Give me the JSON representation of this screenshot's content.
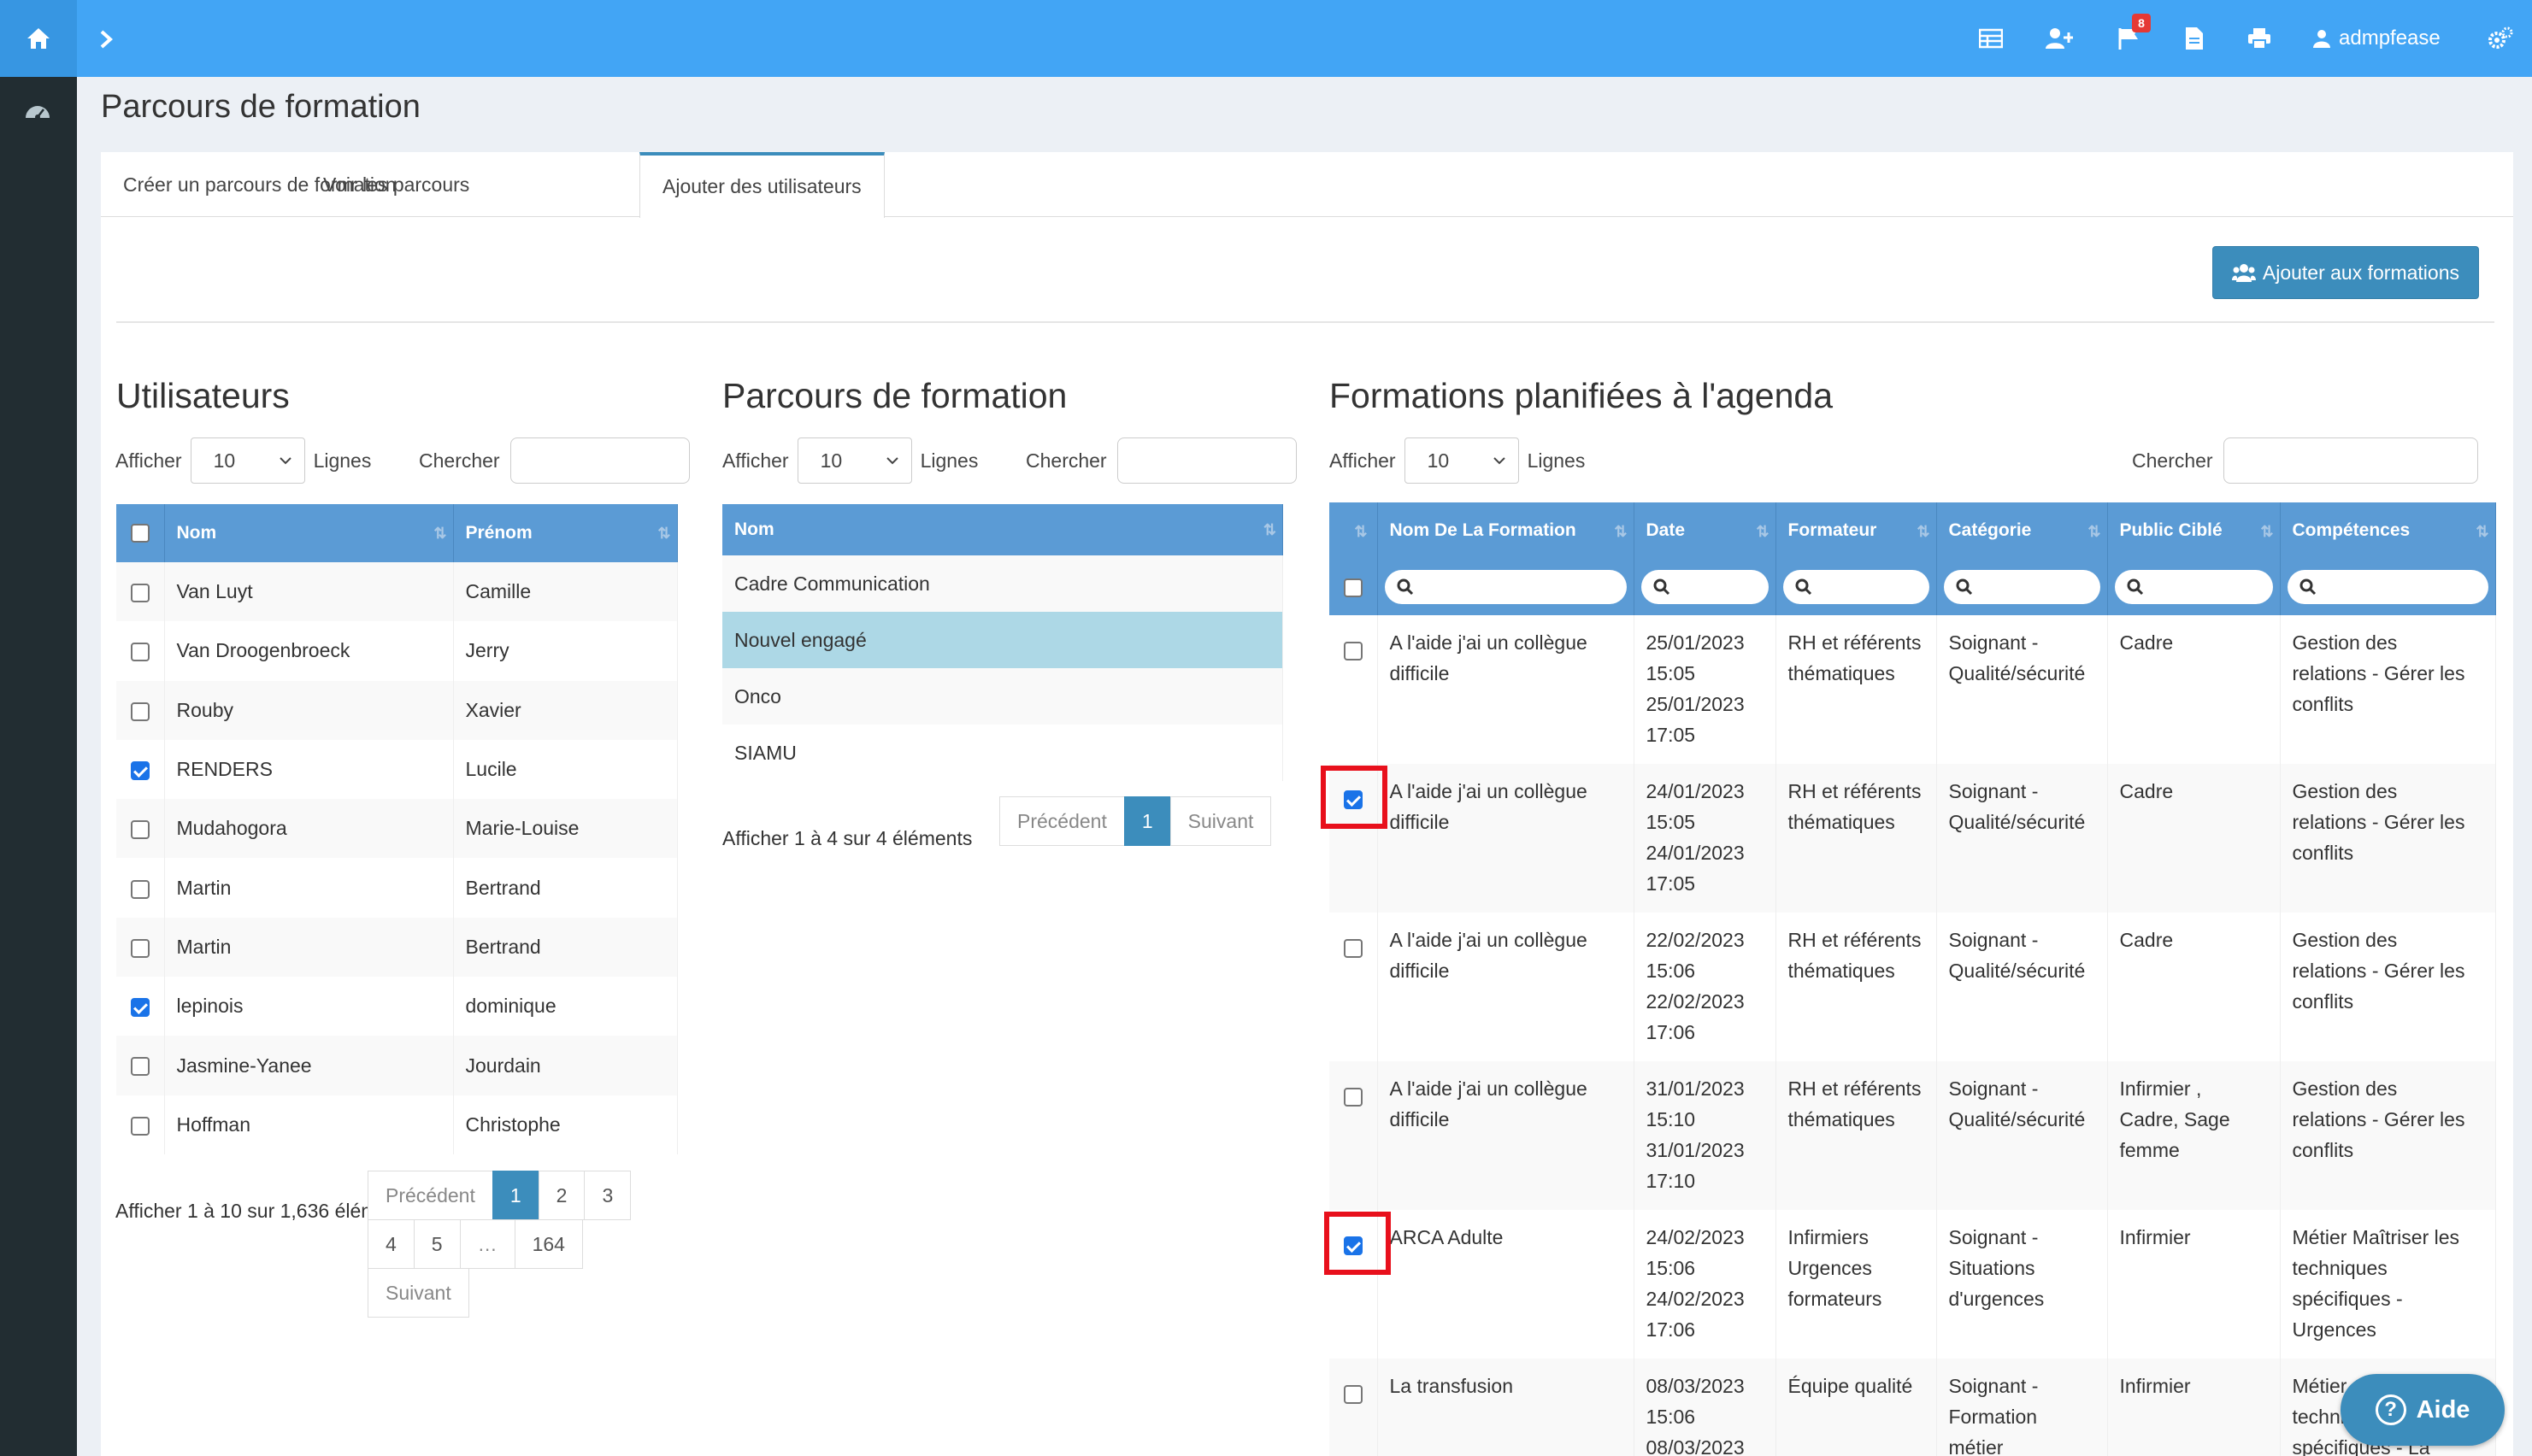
{
  "topbar": {
    "username": "admpfease",
    "notification_count": "8",
    "accent": "#42a5f5",
    "icons": [
      "home-icon",
      "chevron-right-icon",
      "table-icon",
      "user-plus-icon",
      "flag-icon",
      "file-icon",
      "print-icon",
      "user-icon",
      "cogs-icon"
    ]
  },
  "page": {
    "title": "Parcours de formation"
  },
  "tabs": [
    {
      "label": "Créer un parcours de formation"
    },
    {
      "label": "Voir les parcours"
    },
    {
      "label": "Ajouter des utilisateurs"
    }
  ],
  "actions": {
    "add_label": "Ajouter aux formations"
  },
  "users": {
    "title": "Utilisateurs",
    "show_label": "Afficher",
    "show_value": "10",
    "lines_label": "Lignes",
    "search_label": "Chercher",
    "columns": [
      "Nom",
      "Prénom"
    ],
    "rows": [
      {
        "nom": "Van Luyt",
        "prenom": "Camille",
        "checked": false
      },
      {
        "nom": "Van Droogenbroeck",
        "prenom": "Jerry",
        "checked": false
      },
      {
        "nom": "Rouby",
        "prenom": "Xavier",
        "checked": false
      },
      {
        "nom": "RENDERS",
        "prenom": "Lucile",
        "checked": true
      },
      {
        "nom": "Mudahogora",
        "prenom": "Marie-Louise",
        "checked": false
      },
      {
        "nom": "Martin",
        "prenom": "Bertrand",
        "checked": false
      },
      {
        "nom": "Martin",
        "prenom": "Bertrand",
        "checked": false
      },
      {
        "nom": "lepinois",
        "prenom": "dominique",
        "checked": true
      },
      {
        "nom": "Jasmine-Yanee",
        "prenom": "Jourdain",
        "checked": false
      },
      {
        "nom": "Hoffman",
        "prenom": "Christophe",
        "checked": false
      }
    ],
    "info": "Afficher 1 à 10 sur 1,636 élém",
    "pager": {
      "prev": "Précédent",
      "pages": [
        "1",
        "2",
        "3",
        "4",
        "5",
        "…",
        "164"
      ],
      "next": "Suivant"
    }
  },
  "parcours": {
    "title": "Parcours de formation",
    "show_label": "Afficher",
    "show_value": "10",
    "lines_label": "Lignes",
    "search_label": "Chercher",
    "column": "Nom",
    "rows": [
      {
        "nom": "Cadre Communication",
        "selected": false
      },
      {
        "nom": "Nouvel engagé",
        "selected": true
      },
      {
        "nom": "Onco",
        "selected": false
      },
      {
        "nom": "SIAMU",
        "selected": false
      }
    ],
    "info": "Afficher 1 à 4 sur 4 éléments",
    "pager": {
      "prev": "Précédent",
      "page": "1",
      "next": "Suivant"
    }
  },
  "formations": {
    "title": "Formations planifiées à l'agenda",
    "show_label": "Afficher",
    "show_value": "10",
    "lines_label": "Lignes",
    "search_label": "Chercher",
    "columns": [
      "Nom De La Formation",
      "Date",
      "Formateur",
      "Catégorie",
      "Public Ciblé",
      "Compétences"
    ],
    "rows": [
      {
        "checked": false,
        "nom": [
          "A l'aide j'ai un collègue",
          "difficile"
        ],
        "date": [
          "25/01/2023",
          "15:05",
          "25/01/2023",
          "17:05"
        ],
        "formateur": [
          "RH et référents",
          "thématiques"
        ],
        "categorie": [
          "Soignant -",
          "Qualité/sécurité"
        ],
        "public": [
          "Cadre"
        ],
        "competences": [
          "Gestion des",
          "relations - Gérer les",
          "conflits"
        ]
      },
      {
        "checked": true,
        "nom": [
          "A l'aide j'ai un collègue",
          "difficile"
        ],
        "date": [
          "24/01/2023",
          "15:05",
          "24/01/2023",
          "17:05"
        ],
        "formateur": [
          "RH et référents",
          "thématiques"
        ],
        "categorie": [
          "Soignant -",
          "Qualité/sécurité"
        ],
        "public": [
          "Cadre"
        ],
        "competences": [
          "Gestion des",
          "relations - Gérer les",
          "conflits"
        ]
      },
      {
        "checked": false,
        "nom": [
          "A l'aide j'ai un collègue",
          "difficile"
        ],
        "date": [
          "22/02/2023",
          "15:06",
          "22/02/2023",
          "17:06"
        ],
        "formateur": [
          "RH et référents",
          "thématiques"
        ],
        "categorie": [
          "Soignant -",
          "Qualité/sécurité"
        ],
        "public": [
          "Cadre"
        ],
        "competences": [
          "Gestion des",
          "relations - Gérer les",
          "conflits"
        ]
      },
      {
        "checked": false,
        "nom": [
          "A l'aide j'ai un collègue",
          "difficile"
        ],
        "date": [
          "31/01/2023",
          "15:10",
          "31/01/2023",
          "17:10"
        ],
        "formateur": [
          "RH et référents",
          "thématiques"
        ],
        "categorie": [
          "Soignant -",
          "Qualité/sécurité"
        ],
        "public": [
          "Infirmier ,",
          "Cadre, Sage",
          "femme"
        ],
        "competences": [
          "Gestion des",
          "relations - Gérer les",
          "conflits"
        ]
      },
      {
        "checked": true,
        "nom": [
          "ARCA Adulte"
        ],
        "date": [
          "24/02/2023",
          "15:06",
          "24/02/2023",
          "17:06"
        ],
        "formateur": [
          "Infirmiers",
          "Urgences",
          "formateurs"
        ],
        "categorie": [
          "Soignant -",
          "Situations",
          "d'urgences"
        ],
        "public": [
          "Infirmier"
        ],
        "competences": [
          "Métier Maîtriser les",
          "techniques",
          "spécifiques -",
          "Urgences"
        ]
      },
      {
        "checked": false,
        "nom": [
          "La transfusion"
        ],
        "date": [
          "08/03/2023",
          "15:06",
          "08/03/2023"
        ],
        "formateur": [
          "Équipe qualité"
        ],
        "categorie": [
          "Soignant -",
          "Formation",
          "métier"
        ],
        "public": [
          "Infirmier"
        ],
        "competences": [
          "Métier",
          "techniques",
          "spécifiques - La"
        ]
      }
    ]
  },
  "help": {
    "label": "Aide"
  }
}
